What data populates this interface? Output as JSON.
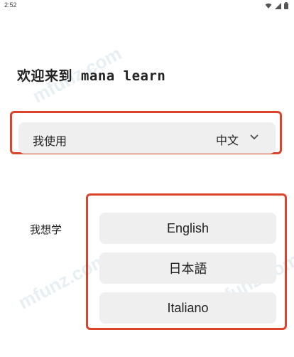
{
  "status_bar": {
    "time": "2:52",
    "icons": [
      "wifi-icon",
      "signal-icon",
      "battery-icon"
    ]
  },
  "welcome": {
    "title": "欢迎来到 mana learn"
  },
  "native_language": {
    "label": "我使用",
    "selected": "中文"
  },
  "learn": {
    "label": "我想学",
    "options": [
      "English",
      "日本語",
      "Italiano"
    ]
  },
  "watermark": {
    "text": "mfunz.com"
  },
  "colors": {
    "highlight": "#d9442b",
    "row_background": "#efefef"
  }
}
